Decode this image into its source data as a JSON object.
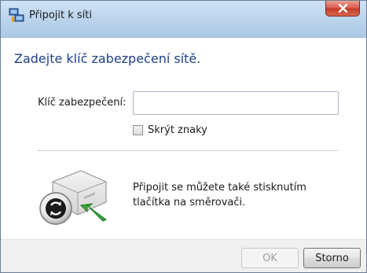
{
  "window": {
    "title": "Připojit k síti"
  },
  "content": {
    "heading": "Zadejte klíč zabezpečení sítě.",
    "key_label": "Klíč zabezpečení:",
    "key_value": "",
    "hide_chars_label": "Skrýt znaky",
    "hide_chars_checked": false,
    "info_text": "Připojit se můžete také stisknutím tlačítka na směrovači."
  },
  "footer": {
    "ok_label": "OK",
    "ok_enabled": false,
    "cancel_label": "Storno"
  },
  "icons": {
    "app": "network-connect-icon",
    "close": "close-icon",
    "router": "router-wps-icon"
  },
  "colors": {
    "heading": "#1e3f8a",
    "close_button": "#c23a26",
    "titlebar": "#bdd6ee"
  }
}
